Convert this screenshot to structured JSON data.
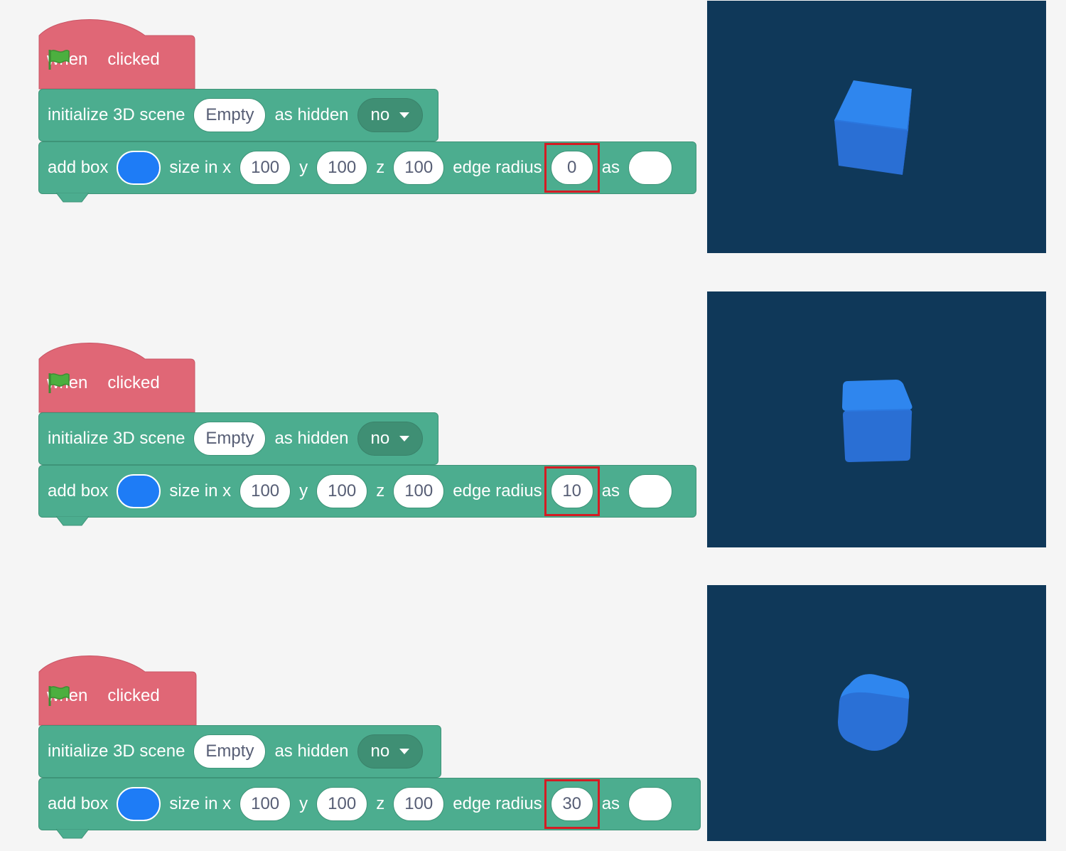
{
  "colors": {
    "background": "#f5f5f5",
    "hat_block": "#e06776",
    "stack_block": "#4cad8f",
    "dropdown": "#3f8f74",
    "box_color": "#1e7cf6",
    "highlight": "#d51b23",
    "preview_background": "#0f3859",
    "flag": "#4caf3f"
  },
  "examples": [
    {
      "hat": {
        "when_label": "when",
        "flag_icon": "green-flag-icon",
        "clicked_label": "clicked"
      },
      "init_block": {
        "label": "initialize 3D scene",
        "scene_value": "Empty",
        "hidden_label": "as hidden",
        "hidden_value": "no"
      },
      "box_block": {
        "label": "add box",
        "size_label": "size in x",
        "x": "100",
        "y_label": "y",
        "y": "100",
        "z_label": "z",
        "z": "100",
        "radius_label": "edge radius",
        "radius": "0",
        "as_label": "as"
      },
      "preview": {
        "edge_radius": 0
      }
    },
    {
      "hat": {
        "when_label": "when",
        "flag_icon": "green-flag-icon",
        "clicked_label": "clicked"
      },
      "init_block": {
        "label": "initialize 3D scene",
        "scene_value": "Empty",
        "hidden_label": "as hidden",
        "hidden_value": "no"
      },
      "box_block": {
        "label": "add box",
        "size_label": "size in x",
        "x": "100",
        "y_label": "y",
        "y": "100",
        "z_label": "z",
        "z": "100",
        "radius_label": "edge radius",
        "radius": "10",
        "as_label": "as"
      },
      "preview": {
        "edge_radius": 10
      }
    },
    {
      "hat": {
        "when_label": "when",
        "flag_icon": "green-flag-icon",
        "clicked_label": "clicked"
      },
      "init_block": {
        "label": "initialize 3D scene",
        "scene_value": "Empty",
        "hidden_label": "as hidden",
        "hidden_value": "no"
      },
      "box_block": {
        "label": "add box",
        "size_label": "size in x",
        "x": "100",
        "y_label": "y",
        "y": "100",
        "z_label": "z",
        "z": "100",
        "radius_label": "edge radius",
        "radius": "30",
        "as_label": "as"
      },
      "preview": {
        "edge_radius": 30
      }
    }
  ]
}
